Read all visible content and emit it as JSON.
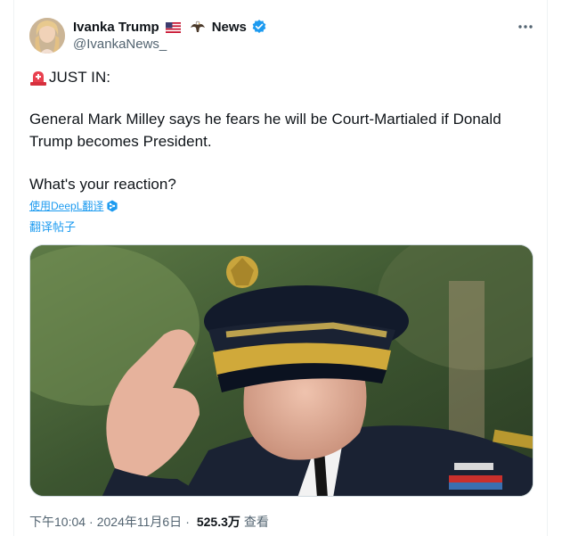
{
  "author": {
    "display_name": "Ivanka Trump",
    "name_suffix": "News",
    "handle": "@IvankaNews_",
    "flag_icon": "us-flag-icon",
    "emoji_icon": "eagle-icon",
    "verified_icon": "verified-badge-icon",
    "verified_color": "#1d9bf0"
  },
  "tweet": {
    "line1_icon": "siren-icon",
    "line1": "JUST IN:",
    "line2": "General Mark Milley says he fears he will be Court-Martialed if Donald",
    "line3": "Trump becomes President.",
    "line4": "What's your reaction?"
  },
  "translate": {
    "deepl_label": "使用DeepL翻译",
    "post_label": "翻译帖子",
    "link_color": "#1d9bf0"
  },
  "media": {
    "alt": "photo",
    "icon": "photo-of-general-saluting"
  },
  "meta": {
    "time": "下午10:04",
    "separator": "·",
    "date": "2024年11月6日",
    "separator2": "·",
    "views_count": "525.3万",
    "views_label": "查看"
  },
  "colors": {
    "text_primary": "#0f1419",
    "text_secondary": "#536471",
    "border": "#eff3f4"
  }
}
